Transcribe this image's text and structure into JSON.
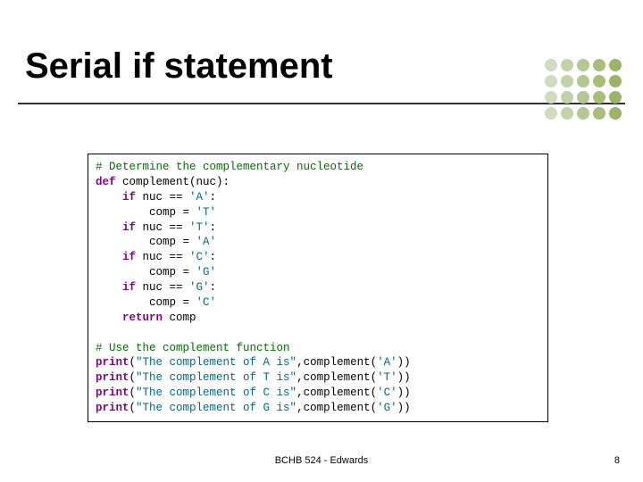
{
  "title": "Serial if statement",
  "code": {
    "c1": "# Determine the complementary nucleotide",
    "l2a": "def",
    "l2b": " complement(nuc):",
    "l3a": "    if",
    "l3b": " nuc == ",
    "l3c": "'A'",
    "l3d": ":",
    "l4a": "        comp = ",
    "l4b": "'T'",
    "l5a": "    if",
    "l5b": " nuc == ",
    "l5c": "'T'",
    "l5d": ":",
    "l6a": "        comp = ",
    "l6b": "'A'",
    "l7a": "    if",
    "l7b": " nuc == ",
    "l7c": "'C'",
    "l7d": ":",
    "l8a": "        comp = ",
    "l8b": "'G'",
    "l9a": "    if",
    "l9b": " nuc == ",
    "l9c": "'G'",
    "l9d": ":",
    "l10a": "        comp = ",
    "l10b": "'C'",
    "l11a": "    return",
    "l11b": " comp",
    "c2": "# Use the complement function",
    "l13a": "print",
    "l13b": "(",
    "l13c": "\"The complement of A is\"",
    "l13d": ",complement(",
    "l13e": "'A'",
    "l13f": "))",
    "l14a": "print",
    "l14b": "(",
    "l14c": "\"The complement of T is\"",
    "l14d": ",complement(",
    "l14e": "'T'",
    "l14f": "))",
    "l15a": "print",
    "l15b": "(",
    "l15c": "\"The complement of C is\"",
    "l15d": ",complement(",
    "l15e": "'C'",
    "l15f": "))",
    "l16a": "print",
    "l16b": "(",
    "l16c": "\"The complement of G is\"",
    "l16d": ",complement(",
    "l16e": "'G'",
    "l16f": "))"
  },
  "footer": "BCHB 524 - Edwards",
  "page": "8"
}
